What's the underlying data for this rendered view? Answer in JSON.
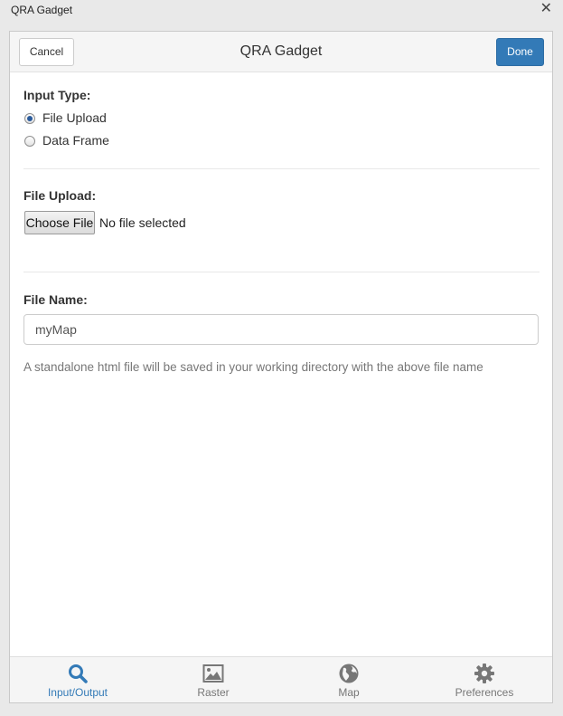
{
  "window": {
    "title": "QRA Gadget",
    "close_glyph": "✕"
  },
  "header": {
    "cancel_label": "Cancel",
    "title": "QRA Gadget",
    "done_label": "Done"
  },
  "input_type": {
    "label": "Input Type:",
    "options": [
      {
        "label": "File Upload",
        "selected": true
      },
      {
        "label": "Data Frame",
        "selected": false
      }
    ]
  },
  "file_upload": {
    "label": "File Upload:",
    "button_label": "Choose File",
    "status": "No file selected"
  },
  "file_name": {
    "label": "File Name:",
    "value": "myMap",
    "help": "A standalone html file will be saved in your working directory with the above file name"
  },
  "tabs": [
    {
      "label": "Input/Output",
      "icon": "search-icon",
      "active": true
    },
    {
      "label": "Raster",
      "icon": "image-icon",
      "active": false
    },
    {
      "label": "Map",
      "icon": "globe-icon",
      "active": false
    },
    {
      "label": "Preferences",
      "icon": "gear-icon",
      "active": false
    }
  ],
  "colors": {
    "accent": "#337ab7",
    "inactive": "#777777"
  }
}
